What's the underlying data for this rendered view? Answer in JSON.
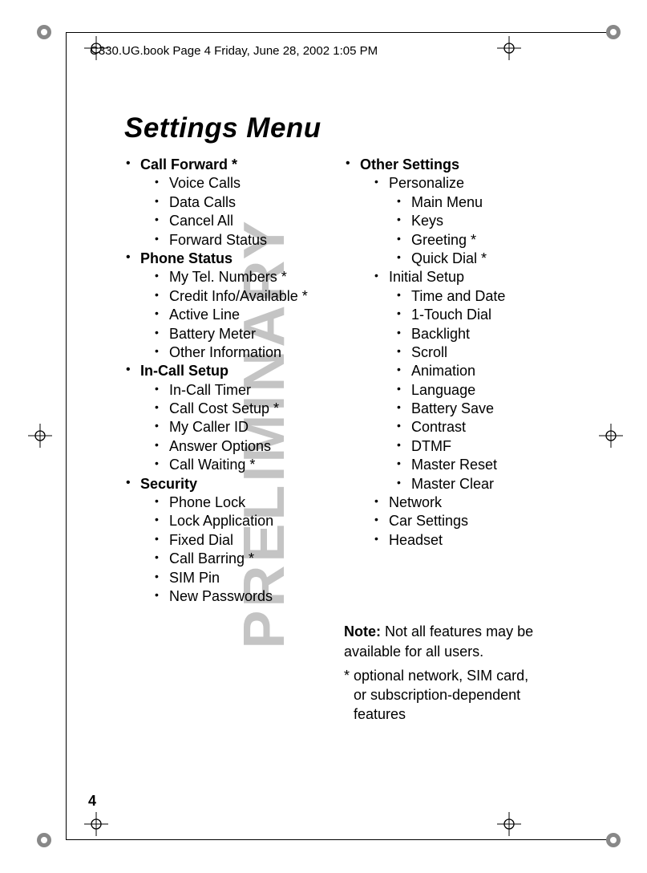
{
  "header_line": "C330.UG.book  Page 4  Friday, June 28, 2002  1:05 PM",
  "title": "Settings Menu",
  "watermark": "PRELIMINARY",
  "page_number": "4",
  "left_column": [
    {
      "label": "Call Forward *",
      "bold": true,
      "children": [
        "Voice Calls",
        "Data Calls",
        "Cancel All",
        "Forward Status"
      ]
    },
    {
      "label": "Phone Status",
      "bold": true,
      "children": [
        "My Tel. Numbers *",
        "Credit Info/Available *",
        "Active Line",
        "Battery Meter",
        "Other Information"
      ]
    },
    {
      "label": "In-Call Setup",
      "bold": true,
      "children": [
        "In-Call Timer",
        "Call Cost Setup *",
        "My Caller ID",
        "Answer Options",
        "Call Waiting *"
      ]
    },
    {
      "label": "Security",
      "bold": true,
      "children": [
        "Phone Lock",
        "Lock Application",
        "Fixed Dial",
        "Call Barring *",
        "SIM Pin",
        "New Passwords"
      ]
    }
  ],
  "right_column": [
    {
      "label": "Other Settings",
      "bold": true,
      "groups": [
        {
          "label": "Personalize",
          "children": [
            "Main Menu",
            "Keys",
            "Greeting *",
            "Quick Dial *"
          ]
        },
        {
          "label": "Initial Setup",
          "children": [
            "Time and Date",
            "1-Touch Dial",
            "Backlight",
            "Scroll",
            "Animation",
            "Language",
            "Battery Save",
            "Contrast",
            "DTMF",
            "Master Reset",
            "Master Clear"
          ]
        },
        {
          "label": "Network"
        },
        {
          "label": "Car Settings"
        },
        {
          "label": "Headset"
        }
      ]
    }
  ],
  "note_label": "Note:",
  "note_text": " Not all features may be available for all users.",
  "footnote": "* optional network, SIM card, or subscription-dependent features"
}
